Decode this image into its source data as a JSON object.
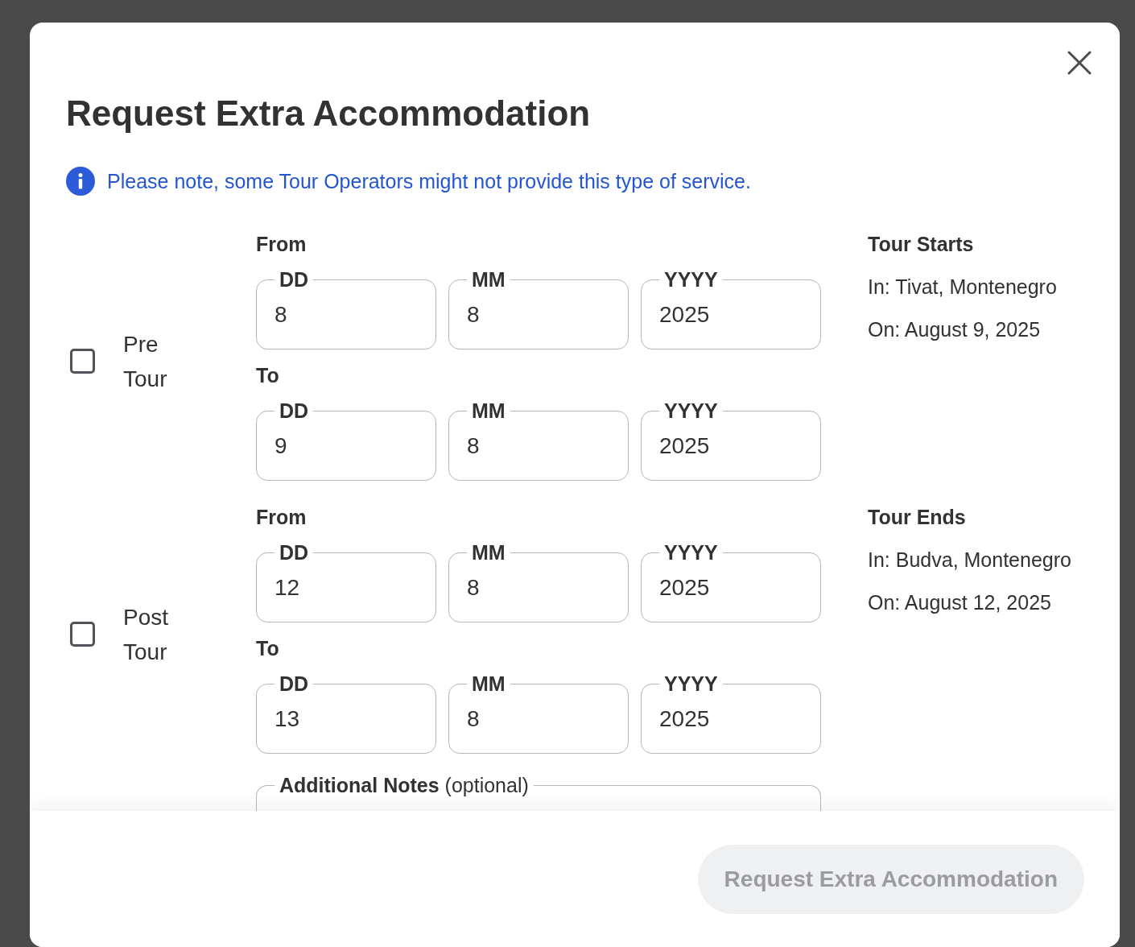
{
  "dialog": {
    "title": "Request Extra Accommodation"
  },
  "notice": {
    "text": "Please note, some Tour Operators might not provide this type of service."
  },
  "sections": [
    {
      "label": "Pre Tour",
      "checked": false,
      "ranges": [
        {
          "label": "From",
          "fields": [
            {
              "label": "DD",
              "value": "8"
            },
            {
              "label": "MM",
              "value": "8"
            },
            {
              "label": "YYYY",
              "value": "2025"
            }
          ]
        },
        {
          "label": "To",
          "fields": [
            {
              "label": "DD",
              "value": "9"
            },
            {
              "label": "MM",
              "value": "8"
            },
            {
              "label": "YYYY",
              "value": "2025"
            }
          ]
        }
      ],
      "info": {
        "title": "Tour Starts",
        "lines": [
          "In: Tivat, Montenegro",
          "On: August 9, 2025"
        ]
      }
    },
    {
      "label": "Post Tour",
      "checked": false,
      "ranges": [
        {
          "label": "From",
          "fields": [
            {
              "label": "DD",
              "value": "12"
            },
            {
              "label": "MM",
              "value": "8"
            },
            {
              "label": "YYYY",
              "value": "2025"
            }
          ]
        },
        {
          "label": "To",
          "fields": [
            {
              "label": "DD",
              "value": "13"
            },
            {
              "label": "MM",
              "value": "8"
            },
            {
              "label": "YYYY",
              "value": "2025"
            }
          ]
        }
      ],
      "info": {
        "title": "Tour Ends",
        "lines": [
          "In: Budva, Montenegro",
          "On: August 12, 2025"
        ]
      }
    }
  ],
  "notes": {
    "label": "**Additional Notes** (optional)"
  },
  "submit": {
    "label": "Request Extra Accommodation",
    "disabled": true
  }
}
